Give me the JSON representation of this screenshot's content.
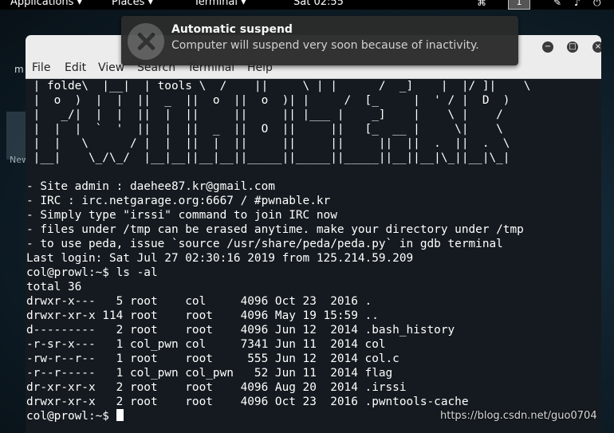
{
  "topbar": {
    "applications": "Applications ▾",
    "places": "Places ▾",
    "terminal": "Terminal ▾",
    "clock": "Sat 02:55",
    "workspace": "1"
  },
  "desktop": {
    "item_a": "m",
    "item_b": "folde",
    "item_c": "tools",
    "item_d": "New Folder"
  },
  "notification": {
    "title": "Automatic suspend",
    "body": "Computer will suspend very soon because of inactivity."
  },
  "window": {
    "menus": [
      "File",
      "Edit",
      "View",
      "Search",
      "Terminal",
      "Help"
    ]
  },
  "terminal": {
    "lines": [
      " | folde\\  |__|  | tools \\  /    ||     \\ | |      /  _]    |  |/ ]|    \\",
      " |  o  )  |  |  ||  _  ||  o  ||  o  )| |     /  [_     |  ' / |  D  )",
      " |   _/|  |  |  ||  |  ||     ||     || |___ |    _]    |    \\ |    /",
      " |  |  |  `  '  ||  |  ||  _  ||  O  ||     ||   [_  __ |     \\|    \\",
      " |  |   \\      / |  |  ||  |  ||     ||     ||     ||  ||  .  ||  .  \\",
      " |__|    \\_/\\_/  |__|__||__|__||_____||_____||_____||__||__|\\_||__|\\_|",
      "",
      "- Site admin : daehee87.kr@gmail.com",
      "- IRC : irc.netgarage.org:6667 / #pwnable.kr",
      "- Simply type \"irssi\" command to join IRC now",
      "- files under /tmp can be erased anytime. make your directory under /tmp",
      "- to use peda, issue `source /usr/share/peda/peda.py` in gdb terminal",
      "Last login: Sat Jul 27 02:30:16 2019 from 125.214.59.209",
      "col@prowl:~$ ls -al",
      "total 36",
      "drwxr-x---   5 root    col     4096 Oct 23  2016 .",
      "drwxr-xr-x 114 root    root    4096 May 19 15:59 ..",
      "d---------   2 root    root    4096 Jun 12  2014 .bash_history",
      "-r-sr-x---   1 col_pwn col     7341 Jun 11  2014 col",
      "-rw-r--r--   1 root    root     555 Jun 12  2014 col.c",
      "-r--r-----   1 col_pwn col_pwn   52 Jun 11  2014 flag",
      "dr-xr-xr-x   2 root    root    4096 Aug 20  2014 .irssi",
      "drwxr-xr-x   2 root    root    4096 Oct 23  2016 .pwntools-cache"
    ],
    "prompt": "col@prowl:~$ "
  },
  "watermark": "https://blog.csdn.net/guo0704"
}
